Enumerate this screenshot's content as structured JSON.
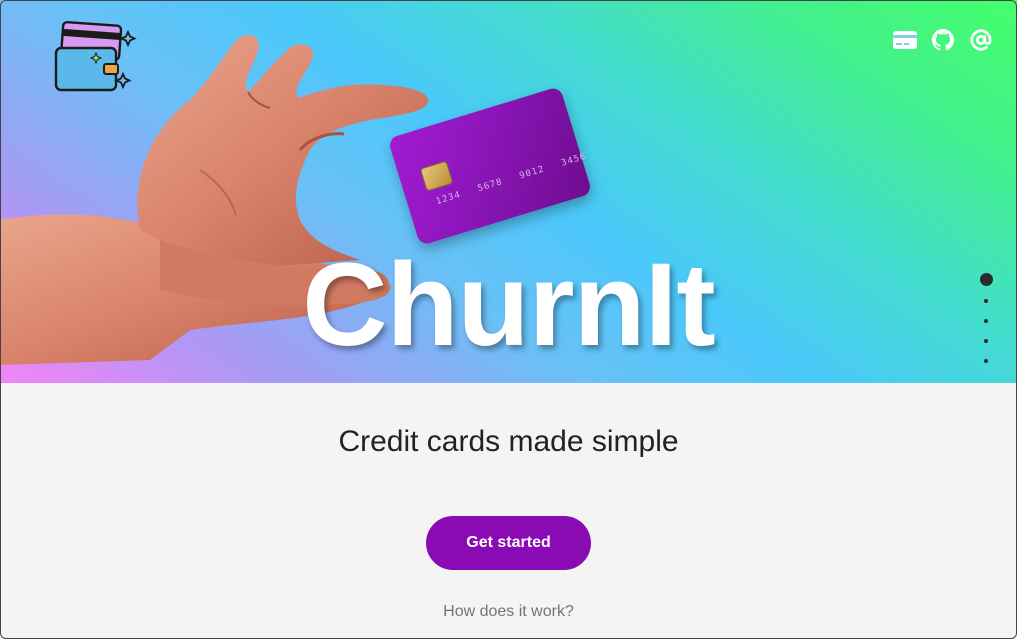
{
  "hero": {
    "title": "ChurnIt",
    "card_numbers": [
      "1234",
      "5678",
      "9012",
      "3456"
    ]
  },
  "nav": {
    "icons": [
      "credit-card-icon",
      "github-icon",
      "at-sign-icon"
    ]
  },
  "pager": {
    "count": 5,
    "active_index": 0
  },
  "main": {
    "tagline": "Credit cards made simple",
    "cta_label": "Get started",
    "how_link": "How does it work?"
  },
  "colors": {
    "accent": "#8a0ab3",
    "gradient_start": "#f384f7",
    "gradient_mid": "#4bc8fb",
    "gradient_end": "#45ff6a"
  }
}
